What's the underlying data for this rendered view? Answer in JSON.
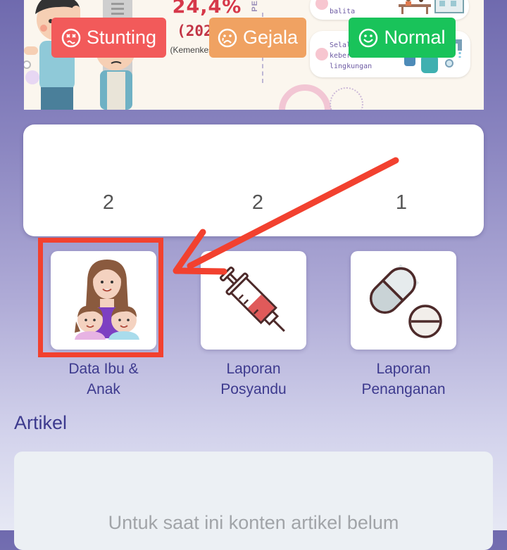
{
  "banner": {
    "stat_value": "24,4%",
    "stat_year": "(2021)",
    "stat_source": "(Kemenkes, 2022)",
    "vertical_label": "PE",
    "tips": [
      {
        "text": "           \nbalita"
      },
      {
        "text": "Selalu menjaga\nkebersihan\nlingkungan"
      }
    ]
  },
  "summary": {
    "badges": [
      {
        "label": "Stunting",
        "count": "2",
        "color": "#f25a5a",
        "icon": "dizzy-face-icon"
      },
      {
        "label": "Gejala",
        "count": "2",
        "color": "#f0a262",
        "icon": "sad-face-icon"
      },
      {
        "label": "Normal",
        "count": "1",
        "color": "#19c35a",
        "icon": "smile-face-icon"
      }
    ]
  },
  "menu": [
    {
      "label": "Data Ibu &\nAnak",
      "icon": "mother-children-icon"
    },
    {
      "label": "Laporan\nPosyandu",
      "icon": "syringe-icon"
    },
    {
      "label": "Laporan\nPenanganan",
      "icon": "pill-icon"
    }
  ],
  "article": {
    "title": "Artikel",
    "empty_text": "Untuk saat ini konten artikel belum"
  },
  "annotation": {
    "color": "#f2412f"
  }
}
